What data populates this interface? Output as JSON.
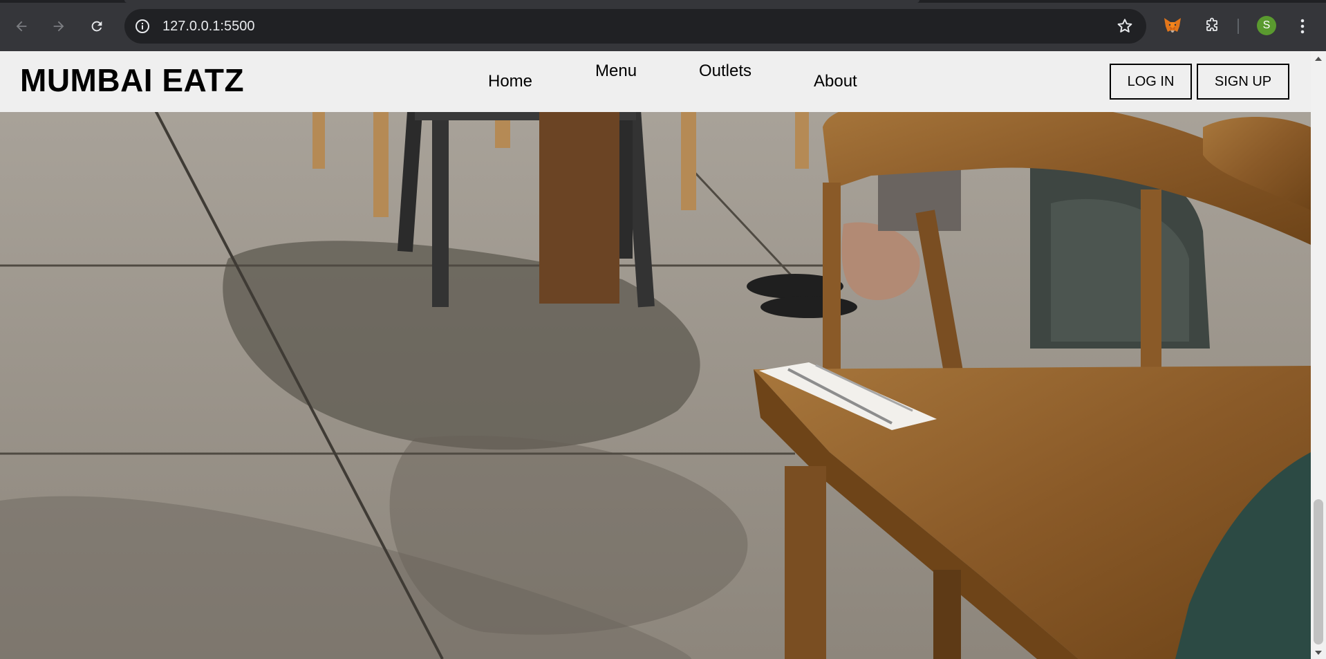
{
  "browser": {
    "url": "127.0.0.1:5500",
    "profile_initial": "S",
    "icons": {
      "back": "arrow-left-icon",
      "forward": "arrow-right-icon",
      "reload": "reload-icon",
      "site_info": "info-icon",
      "bookmark": "star-icon",
      "metamask": "fox-icon",
      "extensions": "puzzle-icon",
      "menu": "kebab-menu-icon"
    }
  },
  "site": {
    "brand": "MUMBAI EATZ",
    "nav": {
      "home": "Home",
      "menu": "Menu",
      "outlets": "Outlets",
      "about": "About"
    },
    "auth": {
      "login": "LOG IN",
      "signup": "SIGN UP"
    }
  },
  "colors": {
    "chrome_bg": "#35363a",
    "omnibox_bg": "#202124",
    "header_bg": "#efefef",
    "avatar_bg": "#5a9a2f"
  }
}
